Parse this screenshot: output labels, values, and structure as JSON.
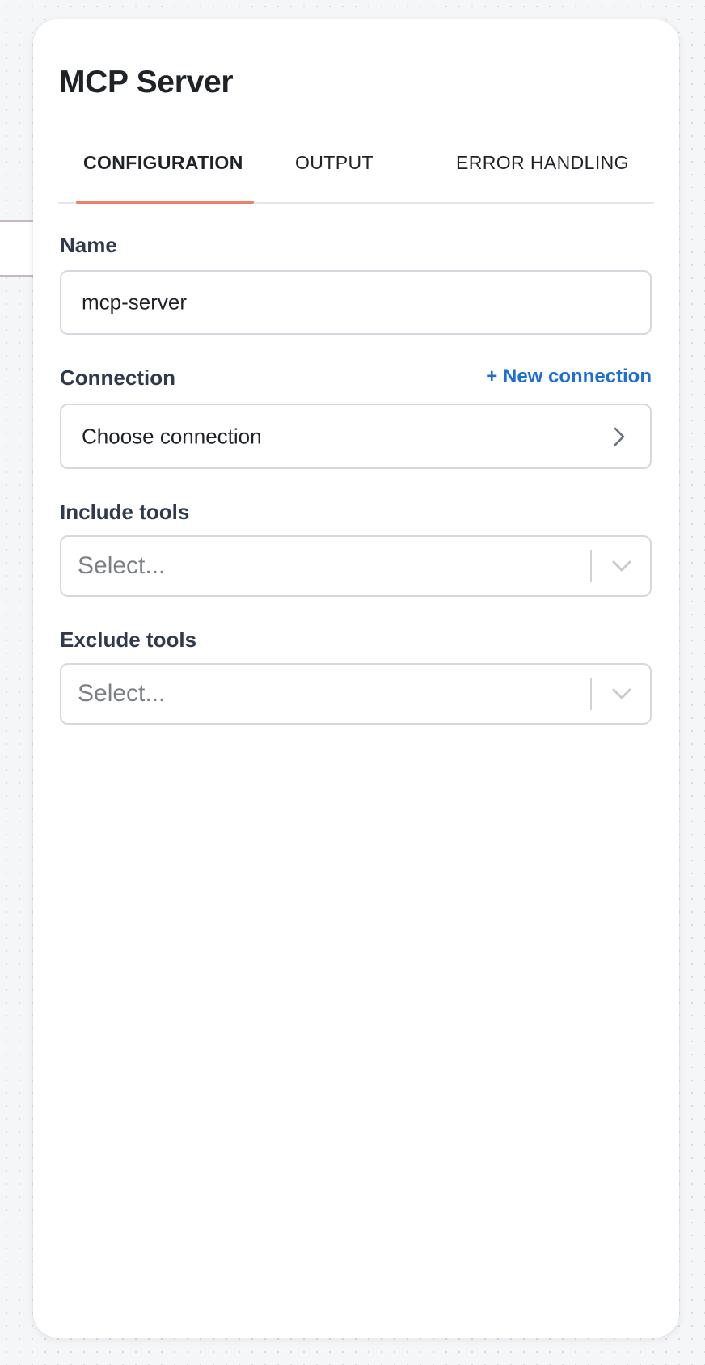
{
  "panel": {
    "title": "MCP Server"
  },
  "tabs": [
    {
      "label": "CONFIGURATION",
      "active": true
    },
    {
      "label": "OUTPUT",
      "active": false
    },
    {
      "label": "ERROR HANDLING",
      "active": false
    }
  ],
  "form": {
    "name": {
      "label": "Name",
      "value": "mcp-server"
    },
    "connection": {
      "label": "Connection",
      "new_link": "+ New connection",
      "value": "Choose connection",
      "icon": "chevron-right-icon"
    },
    "include_tools": {
      "label": "Include tools",
      "placeholder": "Select...",
      "icon": "chevron-down-icon"
    },
    "exclude_tools": {
      "label": "Exclude tools",
      "placeholder": "Select...",
      "icon": "chevron-down-icon"
    }
  },
  "colors": {
    "accent_underline": "#ef7f66",
    "link": "#1d6fd6",
    "label": "#2f3a4d",
    "background": "#f5f6f8"
  }
}
